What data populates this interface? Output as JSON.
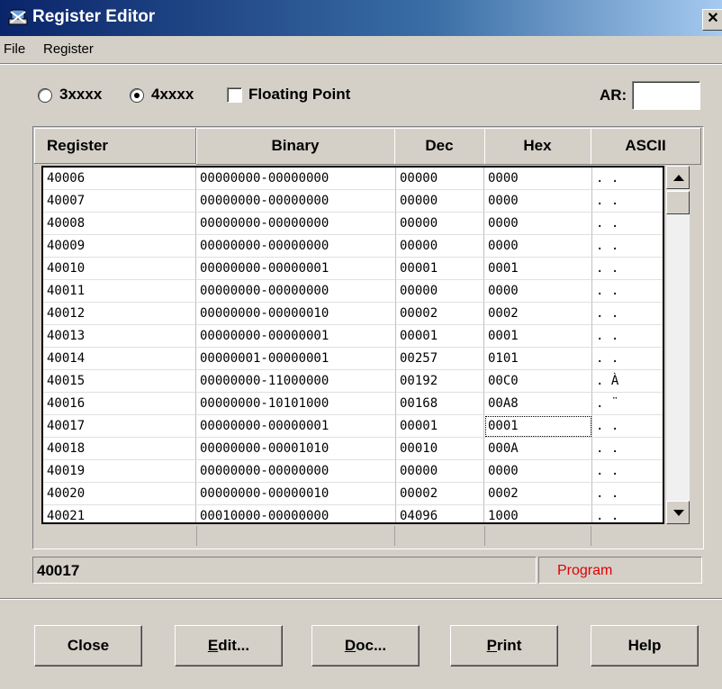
{
  "window": {
    "title": "Register Editor",
    "close_glyph": "✕"
  },
  "menu": [
    "File",
    "Register"
  ],
  "options": {
    "radio_3": "3xxxx",
    "radio_4": "4xxxx",
    "radio_4_selected": true,
    "floating_point": "Floating Point",
    "floating_point_checked": false,
    "ar_label": "AR:",
    "ar_value": ""
  },
  "table": {
    "columns": [
      "Register",
      "Binary",
      "Dec",
      "Hex",
      "ASCII"
    ],
    "rows": [
      {
        "reg": "40006",
        "bin": "00000000-00000000",
        "dec": "00000",
        "hex": "0000",
        "ascii": ". ."
      },
      {
        "reg": "40007",
        "bin": "00000000-00000000",
        "dec": "00000",
        "hex": "0000",
        "ascii": ". ."
      },
      {
        "reg": "40008",
        "bin": "00000000-00000000",
        "dec": "00000",
        "hex": "0000",
        "ascii": ". ."
      },
      {
        "reg": "40009",
        "bin": "00000000-00000000",
        "dec": "00000",
        "hex": "0000",
        "ascii": ". ."
      },
      {
        "reg": "40010",
        "bin": "00000000-00000001",
        "dec": "00001",
        "hex": "0001",
        "ascii": ". ."
      },
      {
        "reg": "40011",
        "bin": "00000000-00000000",
        "dec": "00000",
        "hex": "0000",
        "ascii": ". ."
      },
      {
        "reg": "40012",
        "bin": "00000000-00000010",
        "dec": "00002",
        "hex": "0002",
        "ascii": ". ."
      },
      {
        "reg": "40013",
        "bin": "00000000-00000001",
        "dec": "00001",
        "hex": "0001",
        "ascii": ". ."
      },
      {
        "reg": "40014",
        "bin": "00000001-00000001",
        "dec": "00257",
        "hex": "0101",
        "ascii": ". ."
      },
      {
        "reg": "40015",
        "bin": "00000000-11000000",
        "dec": "00192",
        "hex": "00C0",
        "ascii": ". À"
      },
      {
        "reg": "40016",
        "bin": "00000000-10101000",
        "dec": "00168",
        "hex": "00A8",
        "ascii": ". ¨"
      },
      {
        "reg": "40017",
        "bin": "00000000-00000001",
        "dec": "00001",
        "hex": "0001",
        "ascii": ". ."
      },
      {
        "reg": "40018",
        "bin": "00000000-00001010",
        "dec": "00010",
        "hex": "000A",
        "ascii": ". ."
      },
      {
        "reg": "40019",
        "bin": "00000000-00000000",
        "dec": "00000",
        "hex": "0000",
        "ascii": ". ."
      },
      {
        "reg": "40020",
        "bin": "00000000-00000010",
        "dec": "00002",
        "hex": "0002",
        "ascii": ". ."
      },
      {
        "reg": "40021",
        "bin": "00010000-00000000",
        "dec": "04096",
        "hex": "1000",
        "ascii": ". ."
      }
    ],
    "focused_row": 11
  },
  "status": {
    "register": "40017",
    "mode": "Program",
    "mode_color": "#e00000"
  },
  "buttons": {
    "close": "Close",
    "edit": {
      "mnemonic": "E",
      "rest": "dit..."
    },
    "doc": {
      "mnemonic": "D",
      "rest": "oc..."
    },
    "print": {
      "mnemonic": "P",
      "rest": "rint"
    },
    "help": "Help"
  },
  "icons": {
    "app": "register-editor-app-icon",
    "scroll_up": "arrow-up-icon",
    "scroll_down": "arrow-down-icon"
  }
}
